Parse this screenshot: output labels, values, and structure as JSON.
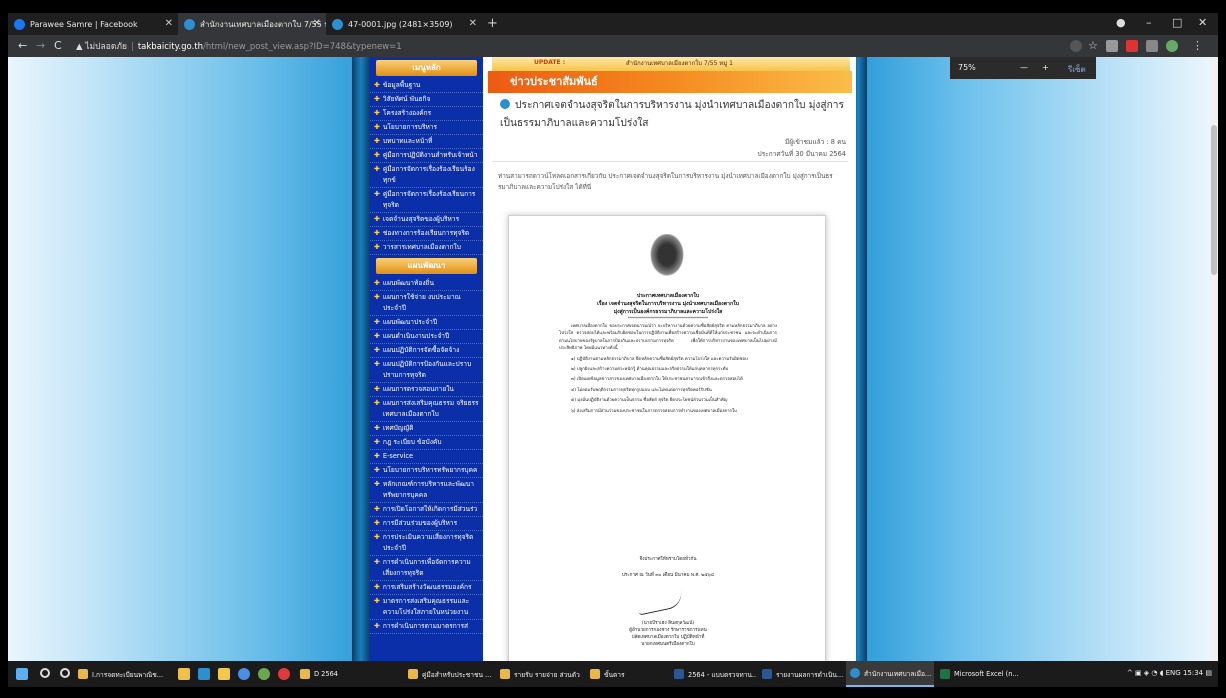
{
  "browser": {
    "tabs": [
      {
        "title": "Parawee Samre | Facebook",
        "icon_color": "#1877f2"
      },
      {
        "title": "สำนักงานเทศบาลเมืองตากใบ 7/55 หมู่",
        "icon_color": "#2b8fd0"
      },
      {
        "title": "47-0001.jpg (2481×3509)",
        "icon_color": "#2b8fd0"
      }
    ],
    "new_tab_glyph": "+",
    "window_buttons": {
      "minimize": "–",
      "maximize": "□",
      "close": "✕"
    },
    "nav": {
      "back": "←",
      "forward": "→",
      "reload": "C"
    },
    "url": {
      "warning": "▲ ไม่ปลอดภัย",
      "domain": "takbaicity.go.th",
      "path": "/html/new_post_view.asp?ID=748&typenew=1"
    },
    "zoom": {
      "level": "75%",
      "minus": "—",
      "plus": "+",
      "reset": "รีเซ็ต"
    }
  },
  "site": {
    "banner": {
      "update_label": "UPDATE :",
      "marquee": "สำนักงานเทศบาลเมืองตากใบ 7/55 หมู่ 1"
    },
    "sidebar": {
      "sections": [
        {
          "title": "เมนูหลัก",
          "items": [
            "ข้อมูลพื้นฐาน",
            "วิสัยทัศน์ พันธกิจ",
            "โครงสร้างองค์กร",
            "นโยบายการบริหาร",
            "บทบาทและหน้าที่",
            "คู่มือการปฏิบัติงานสำหรับเจ้าหน้า",
            "คู่มือการจัดการเรื่องร้องเรียนร้อง ทุกข์",
            "คู่มือการจัดการเรื่องร้องเรียนการ ทุจริต",
            "เจตจำนงสุจริตของผู้บริหาร",
            "ช่องทางการร้องเรียนการทุจริต",
            "วารสารเทศบาลเมืองตากใบ"
          ]
        },
        {
          "title": "แผนพัฒนา",
          "items": [
            "แผนพัฒนาท้องถิ่น",
            "แผนการใช้จ่าย งบประมาณ ประจำปี",
            "แผนพัฒนาประจำปี",
            "แผนดำเนินงานประจำปี",
            "แผนปฏิบัติการจัดซื้อจัดจ้าง",
            "แผนปฏิบัติการป้องกันและปราบ ปรามการทุจริต",
            "แผนการตรวจสอบภายใน",
            "แผนการส่งเสริมคุณธรรม จริยธรร เทศบาลเมืองตากใบ",
            "เทศบัญญัติ",
            "กฎ ระเบียบ ข้อบังคับ",
            "E-service",
            "นโยบายการบริหารทรัพยากรบุคค",
            "หลักเกณฑ์การบริหารและพัฒนา ทรัพยากรบุคคล",
            "การเปิดโอกาสให้เกิดการมีส่วนร่ว",
            "การมีส่วนร่วมของผู้บริหาร",
            "การประเมินความเสี่ยงการทุจริต ประจำปี",
            "การดำเนินการเพื่อจัดการความ เสี่ยงการทุจริต",
            "การเสริมสร้างวัฒนธรรมองค์กร",
            "มาตรการส่งเสริมคุณธรรมและ ความโปร่งใสภายในหน่วยงาน",
            "การดำเนินการตามมาตรการส่"
          ]
        }
      ]
    },
    "news": {
      "section_title": "ข่าวประชาสัมพันธ์",
      "headline": "ประกาศเจตจำนงสุจริตในการบริหารงาน มุ่งนำเทศบาลเมืองตากใบ มุ่งสู่การเป็นธรรมาภิบาลและความโปร่งใส",
      "views": "มีผู้เข้าชมแล้ว : 8 คน",
      "posted": "ประกาศวันที่ 30 มีนาคม 2564",
      "intro": "ท่านสามารถดาวน์โหลดเอกสารเกี่ยวกับ ประกาศเจตจำนงสุจริตในการบริหารงาน มุ่งนำเทศบาลเมืองตากใบ มุ่งสู่การเป็นธรรมาภิบาลและความโปร่งใส ได้ที่นี่"
    },
    "document": {
      "org": "ประกาศเทศบาลเมืองตากใบ",
      "subject_1": "เรื่อง เจตจำนงสุจริตในการบริหารงาน มุ่งนำเทศบาลเมืองตากใบ",
      "subject_2": "มุ่งสู่การเป็นองค์กรธรรมาภิบาลและความโปร่งใส",
      "stars": "****************************************",
      "paragraphs": [
        "เทศบาลเมืองตากใบ ขอประกาศเจตนารมณ์ว่า จะบริหารงานด้วยความซื่อสัตย์สุจริต ตามหลักธรรมาภิบาล อย่างโปร่งใส ตรวจสอบได้และพร้อมรับผิดชอบในการปฏิบัติงานเพื่อสร้างความเชื่อมั่นที่ดีให้แก่ประชาชน และจะดำเนินการตามนโยบายของรัฐบาลในการป้องกันและปราบปรามการทุจริต เพื่อให้การบริหารงานของเทศบาลเป็นไปอย่างมีประสิทธิภาพ โดยมีแนวทางดังนี้",
        "๑) ปฏิบัติงานตามหลักธรรมาภิบาล ยึดหลักความซื่อสัตย์สุจริต ความโปร่งใส และความรับผิดชอบ",
        "๒) ปลูกฝังและสร้างความตระหนักรู้ ด้านคุณธรรมและจริยธรรมให้แก่บุคลากรทุกระดับ",
        "๓) เปิดเผยข้อมูลข่าวสารของเทศบาลเมืองตากใบ ให้ประชาชนสามารถเข้าถึงและตรวจสอบได้",
        "๔) ไม่ยอมรับพฤติกรรมการทุจริตทุกรูปแบบ และไม่ทนต่อการทุจริตคอร์รัปชัน",
        "๕) มุ่งมั่นปฏิบัติงานด้วยความเป็นธรรม ซื่อสัตย์ สุจริต ยึดประโยชน์ส่วนรวมเป็นสำคัญ",
        "๖) ส่งเสริมการมีส่วนร่วมของประชาชนในการตรวจสอบการทำงานของเทศบาลเมืองตากใบ"
      ],
      "announce": "จึงประกาศให้ทราบโดยทั่วกัน",
      "date_line": "ประกาศ ณ วันที่ ๓๐ เดือน มีนาคม พ.ศ. ๒๕๖๔",
      "signer": "(นายบีราเฮง สินสกุลวัฒน์)",
      "signer_role_1": "ผู้อำนวยการกองช่าง รักษาราชการแทน",
      "signer_role_2": "ปลัดเทศบาลเมืองตากใบ ปฏิบัติหน้าที่",
      "signer_role_3": "นายกเทศมนตรีเมืองตากใบ"
    }
  },
  "taskbar": {
    "apps": [
      {
        "label": "I.การจดทะเบียนพาณิช...",
        "icon_color": "#e8b84a"
      },
      {
        "label": "D 2564",
        "icon_color": "#e8b84a"
      },
      {
        "label": "คู่มือสำหรับประชาชน ...",
        "icon_color": "#e8b84a"
      },
      {
        "label": "รายรับ รายจ่าย ส่วนตัว",
        "icon_color": "#e8b84a"
      },
      {
        "label": "ขั้นตาร",
        "icon_color": "#e8b84a"
      },
      {
        "label": "2564 - แบบตรวจทาน...",
        "icon_color": "#2b5797"
      },
      {
        "label": "รายงานผลการดำเนิน...",
        "icon_color": "#2b5797"
      },
      {
        "label": "สำนักงานเทศบาลเมือ...",
        "icon_color": "#2b8fd0"
      },
      {
        "label": "Microsoft Excel (n...",
        "icon_color": "#1f7244"
      }
    ],
    "tray": {
      "lang": "ENG",
      "time": "15:34"
    }
  }
}
